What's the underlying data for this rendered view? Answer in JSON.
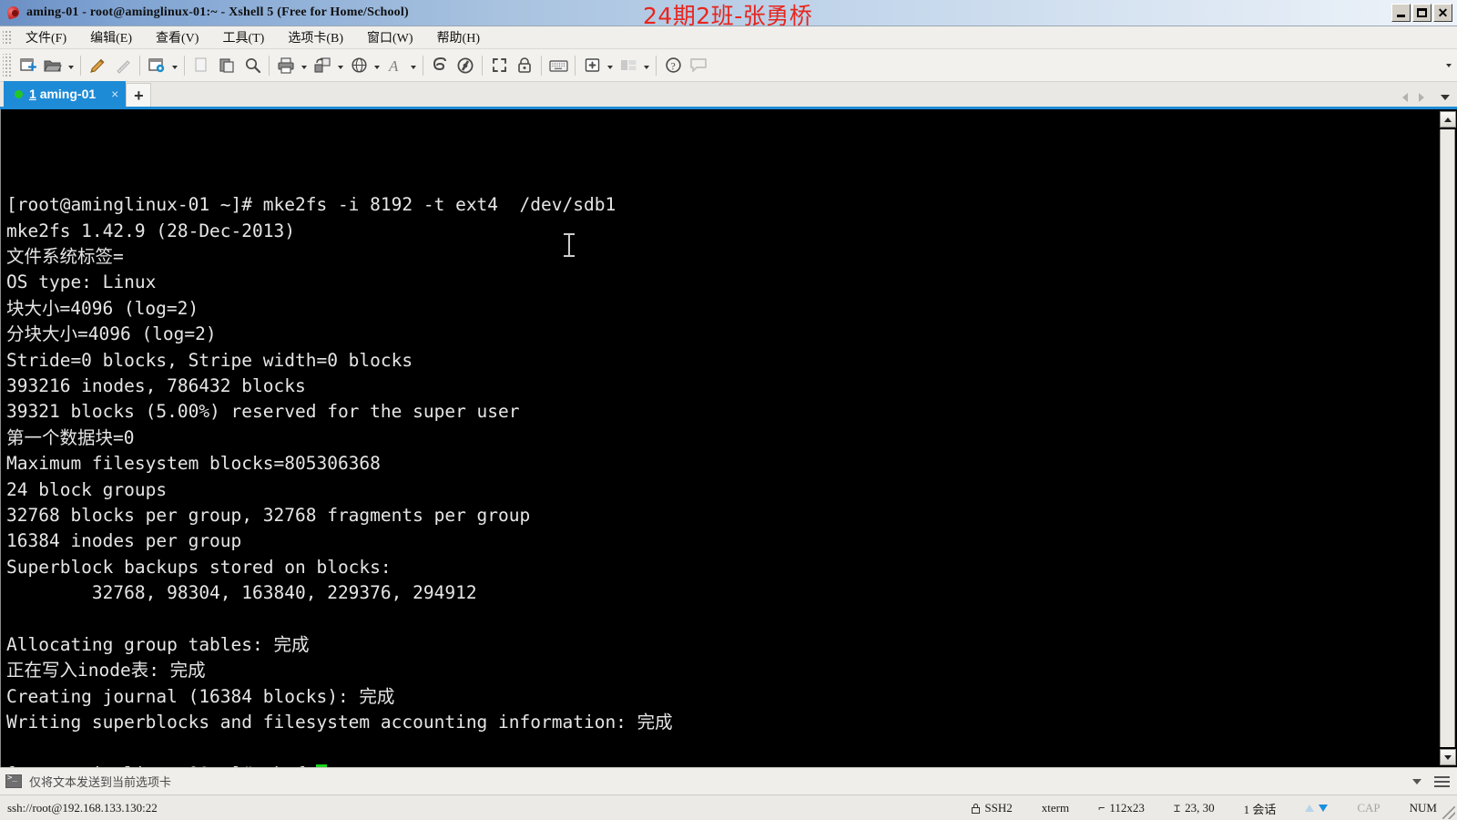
{
  "window": {
    "title": "aming-01 - root@aminglinux-01:~ - Xshell 5 (Free for Home/School)",
    "watermark": "24期2班-张勇桥",
    "app_icon": "xshell-icon",
    "minimize_label": "_",
    "maximize_label": "□",
    "close_label": "✕"
  },
  "menu": {
    "items": [
      {
        "label": "文件(F)",
        "name": "menu-file"
      },
      {
        "label": "编辑(E)",
        "name": "menu-edit"
      },
      {
        "label": "查看(V)",
        "name": "menu-view"
      },
      {
        "label": "工具(T)",
        "name": "menu-tools"
      },
      {
        "label": "选项卡(B)",
        "name": "menu-tabs"
      },
      {
        "label": "窗口(W)",
        "name": "menu-window"
      },
      {
        "label": "帮助(H)",
        "name": "menu-help"
      }
    ]
  },
  "toolbar": {
    "icons": [
      "new-session-icon",
      "open-folder-icon",
      "edit-pencil-icon",
      "ruler-icon",
      "session-properties-icon",
      "copy-icon",
      "paste-icon",
      "find-icon",
      "print-icon",
      "file-transfer-icon",
      "globe-icon",
      "font-icon",
      "session-manager-icon",
      "compose-pane-icon",
      "fullscreen-icon",
      "lock-icon",
      "keyboard-icon",
      "add-tab-icon",
      "arrange-layout-icon",
      "help-icon",
      "chat-icon"
    ],
    "overflow_label": "▾"
  },
  "tabs": {
    "active": {
      "index": "1",
      "label": "aming-01",
      "status": "connected",
      "close_label": "×"
    },
    "new_tab_label": "+",
    "nav_prev": "◀",
    "nav_next": "▶",
    "nav_list": "▾"
  },
  "terminal": {
    "lines": [
      "[root@aminglinux-01 ~]# mke2fs -i 8192 -t ext4  /dev/sdb1",
      "mke2fs 1.42.9 (28-Dec-2013)",
      "文件系统标签=",
      "OS type: Linux",
      "块大小=4096 (log=2)",
      "分块大小=4096 (log=2)",
      "Stride=0 blocks, Stripe width=0 blocks",
      "393216 inodes, 786432 blocks",
      "39321 blocks (5.00%) reserved for the super user",
      "第一个数据块=0",
      "Maximum filesystem blocks=805306368",
      "24 block groups",
      "32768 blocks per group, 32768 fragments per group",
      "16384 inodes per group",
      "Superblock backups stored on blocks:",
      "        32768, 98304, 163840, 229376, 294912",
      "",
      "Allocating group tables: 完成",
      "正在写入inode表: 完成",
      "Creating journal (16384 blocks): 完成",
      "Writing superblocks and filesystem accounting information: 完成",
      ""
    ],
    "prompt": "[root@aminglinux-01 ~]# ",
    "typed_command": "mkefs",
    "cursor_color": "#18d718",
    "background": "#000000",
    "foreground": "#e6e6e6"
  },
  "sendbar": {
    "icon": "terminal-prompt-icon",
    "label": "仅将文本发送到当前选项卡",
    "dropdown": "▾",
    "menu_icon": "hamburger-icon"
  },
  "statusbar": {
    "connection_url": "ssh://root@192.168.133.130:22",
    "protocol": "SSH2",
    "term_type": "xterm",
    "size": "112x23",
    "cursor_position": "23, 30",
    "sessions": "1 会话",
    "cap": "CAP",
    "num": "NUM"
  }
}
